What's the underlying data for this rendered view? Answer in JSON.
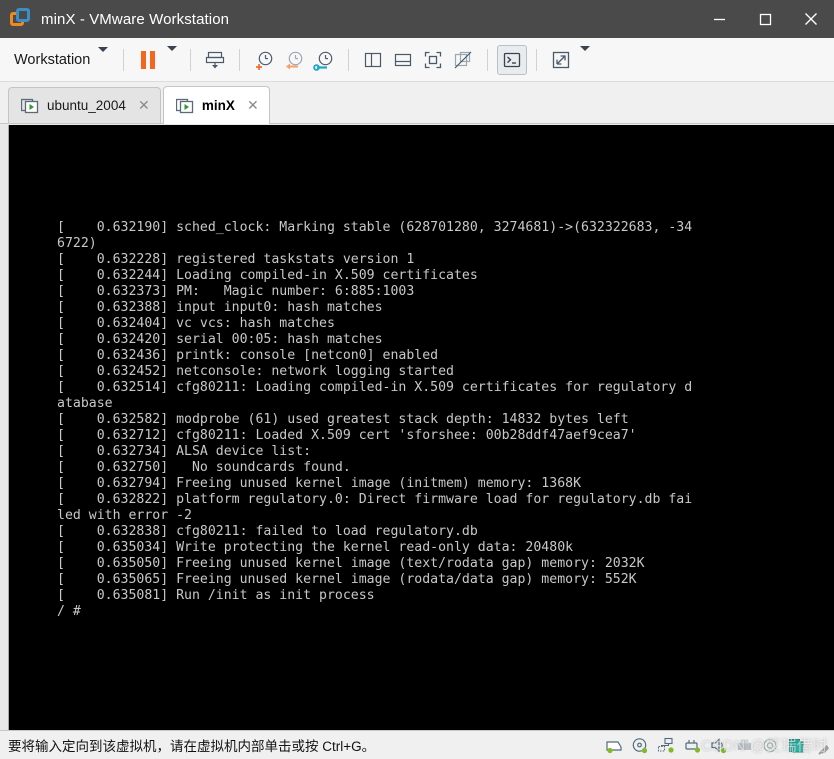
{
  "window": {
    "title": "minX - VMware Workstation",
    "logo_icon": "vmware-logo-icon",
    "controls": {
      "minimize": "minimize-icon",
      "maximize": "maximize-icon",
      "close": "close-icon"
    }
  },
  "toolbar": {
    "menu_label": "Workstation",
    "menu_caret": "chevron-down-icon",
    "buttons": [
      {
        "name": "suspend-button",
        "icon": "pause-icon",
        "title": "Suspend"
      },
      {
        "name": "power-dropdown-button",
        "icon": "chevron-down-icon",
        "title": "Power"
      },
      {
        "name": "send-ctrl-alt-del-button",
        "icon": "send-key-icon",
        "title": "Send Ctrl+Alt+Del"
      },
      {
        "name": "take-snapshot-button",
        "icon": "clock-plus-icon",
        "title": "Take snapshot"
      },
      {
        "name": "revert-snapshot-button",
        "icon": "clock-revert-icon",
        "title": "Revert to snapshot"
      },
      {
        "name": "snapshot-manager-button",
        "icon": "clock-wrench-icon",
        "title": "Manage snapshots"
      },
      {
        "name": "show-library-button",
        "icon": "panel-left-icon",
        "title": "Show library"
      },
      {
        "name": "show-thumbnails-button",
        "icon": "panel-bottom-icon",
        "title": "Show thumbnail bar"
      },
      {
        "name": "fullscreen-button",
        "icon": "fullscreen-icon",
        "title": "Enter full screen"
      },
      {
        "name": "unity-mode-button",
        "icon": "unity-off-icon",
        "title": "Unity mode"
      },
      {
        "name": "console-view-button",
        "icon": "console-icon",
        "title": "Console view",
        "active": true
      },
      {
        "name": "stretch-guest-button",
        "icon": "expand-diagonal-icon",
        "title": "Stretch guest"
      },
      {
        "name": "stretch-dropdown-button",
        "icon": "chevron-down-icon",
        "title": "Stretch options"
      }
    ]
  },
  "tabs": [
    {
      "label": "ubuntu_2004",
      "icon": "vm-play-icon",
      "close_icon": "close-icon",
      "active": false
    },
    {
      "label": "minX",
      "icon": "vm-play-icon",
      "close_icon": "close-icon",
      "active": true
    }
  ],
  "console": {
    "background": "#000000",
    "foreground": "#c8c8c8",
    "lines": [
      "[    0.632190] sched_clock: Marking stable (628701280, 3274681)->(632322683, -34",
      "6722)",
      "[    0.632228] registered taskstats version 1",
      "[    0.632244] Loading compiled-in X.509 certificates",
      "[    0.632373] PM:   Magic number: 6:885:1003",
      "[    0.632388] input input0: hash matches",
      "[    0.632404] vc vcs: hash matches",
      "[    0.632420] serial 00:05: hash matches",
      "[    0.632436] printk: console [netcon0] enabled",
      "[    0.632452] netconsole: network logging started",
      "[    0.632514] cfg80211: Loading compiled-in X.509 certificates for regulatory d",
      "atabase",
      "[    0.632582] modprobe (61) used greatest stack depth: 14832 bytes left",
      "[    0.632712] cfg80211: Loaded X.509 cert 'sforshee: 00b28ddf47aef9cea7'",
      "[    0.632734] ALSA device list:",
      "[    0.632750]   No soundcards found.",
      "[    0.632794] Freeing unused kernel image (initmem) memory: 1368K",
      "[    0.632822] platform regulatory.0: Direct firmware load for regulatory.db fai",
      "led with error -2",
      "[    0.632838] cfg80211: failed to load regulatory.db",
      "[    0.635034] Write protecting the kernel read-only data: 20480k",
      "[    0.635050] Freeing unused kernel image (text/rodata gap) memory: 2032K",
      "[    0.635065] Freeing unused kernel image (rodata/data gap) memory: 552K",
      "[    0.635081] Run /init as init process",
      "/ #"
    ]
  },
  "statusbar": {
    "message": "要将输入定向到该虚拟机，请在虚拟机内部单击或按 Ctrl+G。",
    "devices": [
      {
        "name": "status-hard-disk-icon",
        "title": "Hard Disk"
      },
      {
        "name": "status-cd-dvd-icon",
        "title": "CD/DVD"
      },
      {
        "name": "status-network-icon",
        "title": "Network Adapter"
      },
      {
        "name": "status-usb-icon",
        "title": "USB Devices"
      },
      {
        "name": "status-sound-icon",
        "title": "Sound Card"
      },
      {
        "name": "status-printer-icon",
        "title": "Printer"
      },
      {
        "name": "status-display-icon",
        "title": "Display"
      },
      {
        "name": "status-copy-icon",
        "title": "Shared Folders"
      }
    ],
    "grip_icon": "resize-grip-icon",
    "watermark": "CSDN @艾瑞借时"
  },
  "colors": {
    "titlebar_bg": "#4a4a4a",
    "toolbar_bg": "#f7f7f7",
    "accent_orange": "#f2661f",
    "accent_blue": "#3a8fc4",
    "status_green": "#7fba28"
  }
}
